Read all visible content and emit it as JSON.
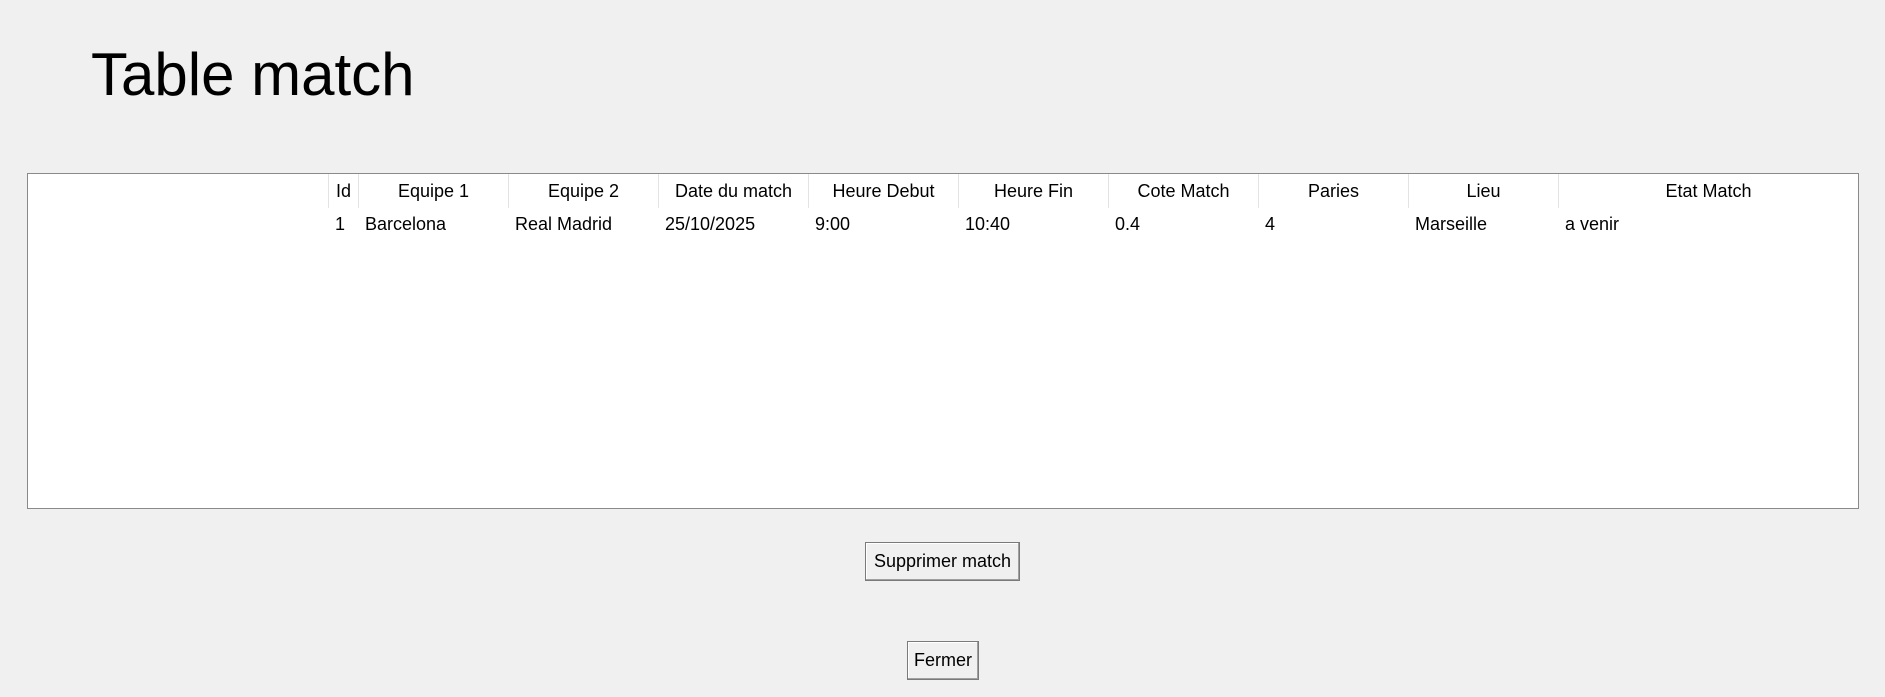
{
  "window": {
    "title": "Table match"
  },
  "table": {
    "columns": [
      "Id",
      "Equipe 1",
      "Equipe 2",
      "Date du match",
      "Heure Debut",
      "Heure Fin",
      "Cote Match",
      "Paries",
      "Lieu",
      "Etat Match"
    ],
    "rows": [
      [
        "1",
        "Barcelona",
        "Real Madrid",
        "25/10/2025",
        "9:00",
        "10:40",
        "0.4",
        "4",
        "Marseille",
        "a venir"
      ]
    ]
  },
  "buttons": {
    "delete_label": "Supprimer match",
    "close_label": "Fermer"
  }
}
